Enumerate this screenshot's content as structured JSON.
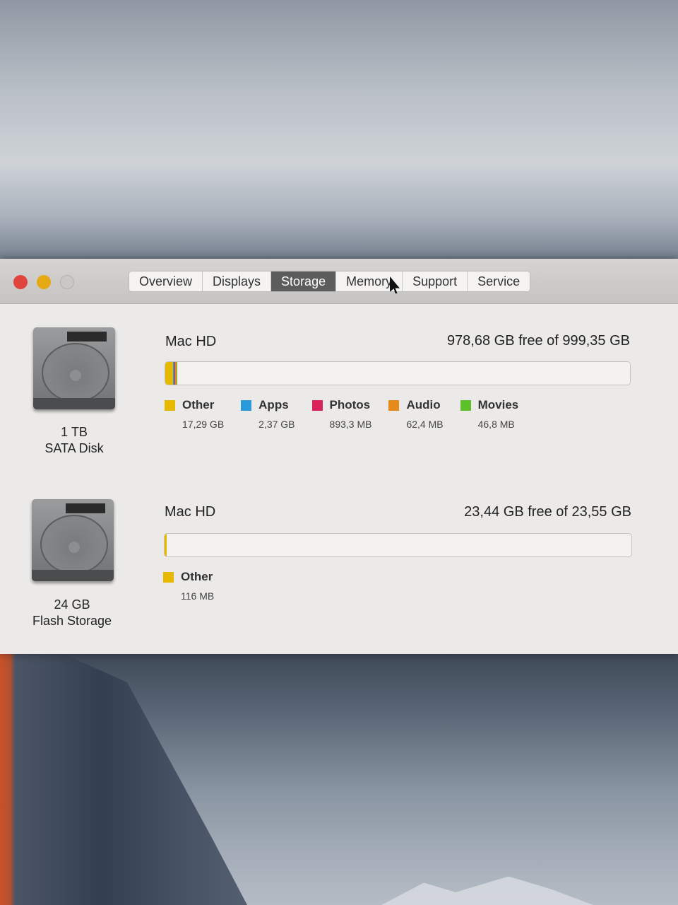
{
  "window": {
    "tabs": [
      {
        "label": "Overview",
        "active": false
      },
      {
        "label": "Displays",
        "active": false
      },
      {
        "label": "Storage",
        "active": true
      },
      {
        "label": "Memory",
        "active": false
      },
      {
        "label": "Support",
        "active": false
      },
      {
        "label": "Service",
        "active": false
      }
    ]
  },
  "disks": [
    {
      "size": "1 TB",
      "type": "SATA Disk",
      "name": "Mac HD",
      "free_text": "978,68 GB free of 999,35 GB",
      "capacity_gb": 999.35,
      "categories": [
        {
          "label": "Other",
          "size": "17,29 GB",
          "gb": 17.29,
          "color": "#e6b800"
        },
        {
          "label": "Apps",
          "size": "2,37 GB",
          "gb": 2.37,
          "color": "#2a9ad8"
        },
        {
          "label": "Photos",
          "size": "893,3 MB",
          "gb": 0.8933,
          "color": "#d8245a"
        },
        {
          "label": "Audio",
          "size": "62,4 MB",
          "gb": 0.0624,
          "color": "#e68a1a"
        },
        {
          "label": "Movies",
          "size": "46,8 MB",
          "gb": 0.0468,
          "color": "#5cc02a"
        }
      ]
    },
    {
      "size": "24 GB",
      "type": "Flash Storage",
      "name": "Mac HD",
      "free_text": "23,44 GB free of 23,55 GB",
      "capacity_gb": 23.55,
      "categories": [
        {
          "label": "Other",
          "size": "116 MB",
          "gb": 0.116,
          "color": "#e6b800"
        }
      ]
    }
  ]
}
